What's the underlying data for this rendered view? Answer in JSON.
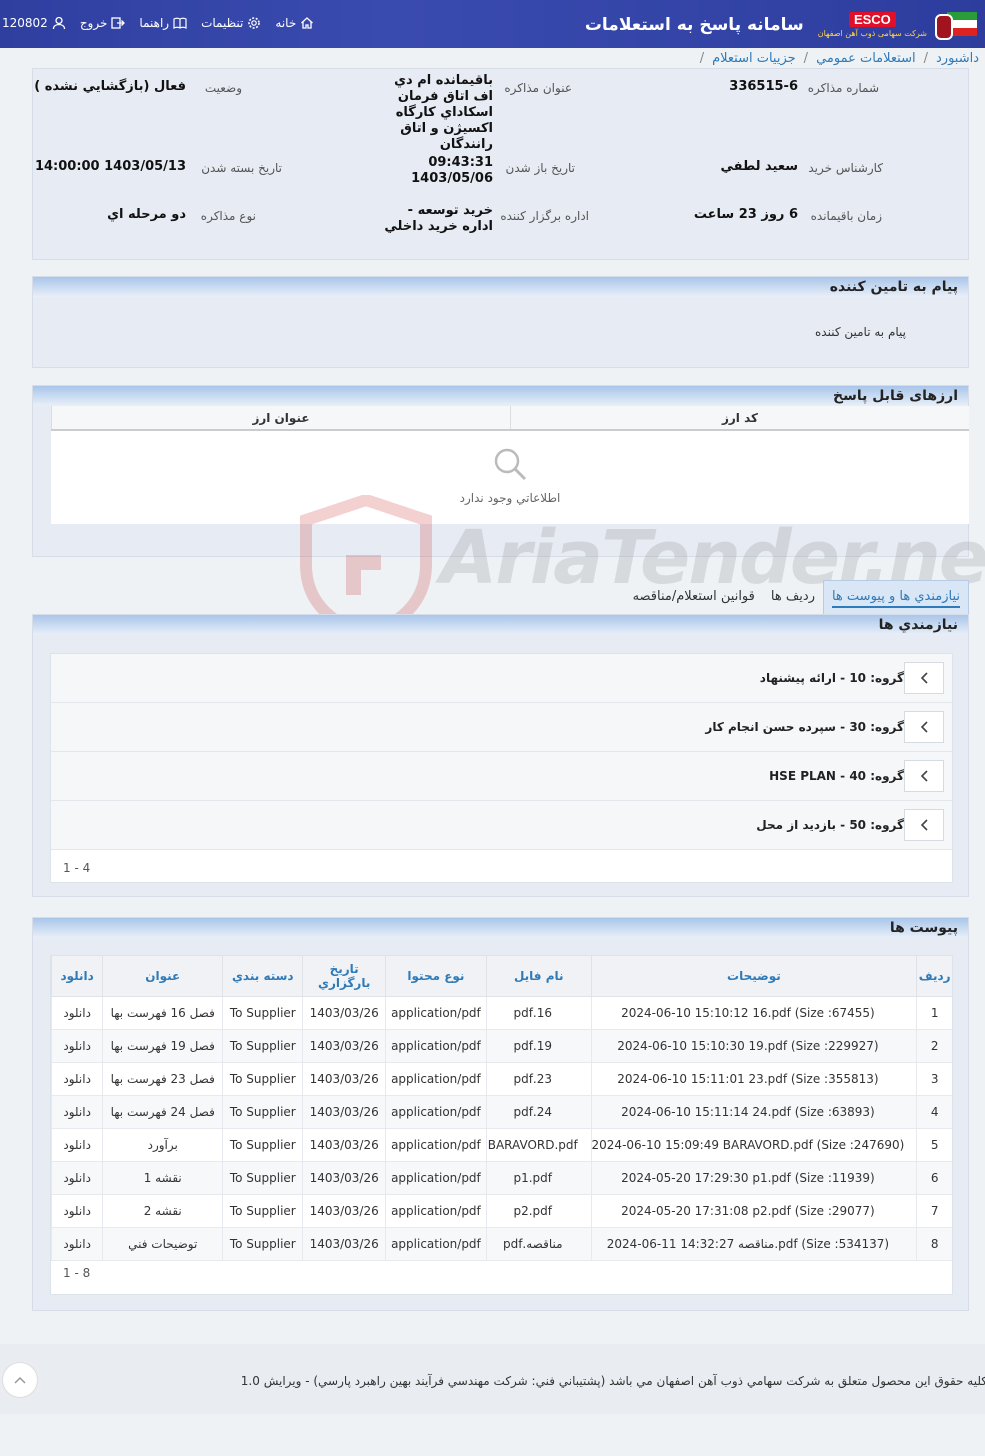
{
  "header": {
    "app_title": "سامانه پاسخ به استعلامات",
    "esco_mark": "ESCO",
    "esco_sub": "شرکت سهامی ذوب آهن اصفهان",
    "user_id": "120802",
    "logout": "خروج",
    "help": "راهنما",
    "settings": "تنظیمات",
    "home": "خانه"
  },
  "breadcrumb": [
    "داشبورد",
    "استعلامات عمومي",
    "جزييات استعلام"
  ],
  "info": {
    "number_label": "شماره مذاكره",
    "number_value": "336515-6",
    "title_label": "عنوان مذاكره",
    "title_value": "باقيمانده ام دي اف اتاق فرمان اسكاداي كارگاه اكسيژن و اتاق رانندگان",
    "status_label": "وضعيت",
    "status_value": "فعال (بازگشايي نشده )",
    "buyer_label": "كارشناس خريد",
    "buyer_value": "سعيد لطفي",
    "open_label": "تاريخ باز شدن",
    "open_time": "09:43:31",
    "open_date": "1403/05/06",
    "close_label": "تاريخ بسته شدن",
    "close_value": "1403/05/13 14:00:00",
    "remain_label": "زمان باقيمانده",
    "remain_value": "6 روز 23 ساعت",
    "dept_label": "اداره برگزار كننده",
    "dept_value": "خريد توسعه - اداره خريد داخلي",
    "type_label": "نوع مذاكره",
    "type_value": "دو مرحله اي"
  },
  "message": {
    "title": "پیام به تامین کننده",
    "text": "پیام به تامین کننده"
  },
  "currency": {
    "title": "ارزهای قابل پاسخ",
    "col_code": "کد ارز",
    "col_title": "عنوان ارز",
    "empty": "اطلاعاتي وجود ندارد"
  },
  "watermark": "AriaTender.neT",
  "tabs": [
    "نیازمندي ها و پیوست ها",
    "رديف ها",
    "قوانين استعلام/مناقصه"
  ],
  "requirements": {
    "title": "نيازمندي ها",
    "groups": [
      "گروه: 10 - ارائه پیشنهاد",
      "گروه: 30 - سپرده حسن انجام کار",
      "گروه: 40 - HSE PLAN",
      "گروه: 50 - بازديد از محل"
    ],
    "pager": "1 - 4"
  },
  "attachments": {
    "title": "پیوست ها",
    "columns": [
      "رديف",
      "توضيحات",
      "نام فايل",
      "نوع محتوا",
      "تاريخ بارگزاري",
      "دسته بندي",
      "عنوان",
      "دانلود"
    ],
    "rows": [
      [
        "1",
        "2024-06-10 15:10:12 16.pdf (Size :67455)",
        "16.pdf",
        "application/pdf",
        "1403/03/26",
        "To Supplier",
        "فصل 16 فهرست بها",
        "دانلود"
      ],
      [
        "2",
        "2024-06-10 15:10:30 19.pdf (Size :229927)",
        "19.pdf",
        "application/pdf",
        "1403/03/26",
        "To Supplier",
        "فصل 19 فهرست بها",
        "دانلود"
      ],
      [
        "3",
        "2024-06-10 15:11:01 23.pdf (Size :355813)",
        "23.pdf",
        "application/pdf",
        "1403/03/26",
        "To Supplier",
        "فصل 23 فهرست بها",
        "دانلود"
      ],
      [
        "4",
        "2024-06-10 15:11:14 24.pdf (Size :63893)",
        "24.pdf",
        "application/pdf",
        "1403/03/26",
        "To Supplier",
        "فصل 24 فهرست بها",
        "دانلود"
      ],
      [
        "5",
        "2024-06-10 15:09:49 BARAVORD.pdf (Size :247690)",
        "BARAVORD.pdf",
        "application/pdf",
        "1403/03/26",
        "To Supplier",
        "برآورد",
        "دانلود"
      ],
      [
        "6",
        "2024-05-20 17:29:30 p1.pdf (Size :11939)",
        "p1.pdf",
        "application/pdf",
        "1403/03/26",
        "To Supplier",
        "نقشه 1",
        "دانلود"
      ],
      [
        "7",
        "2024-05-20 17:31:08 p2.pdf (Size :29077)",
        "p2.pdf",
        "application/pdf",
        "1403/03/26",
        "To Supplier",
        "نقشه 2",
        "دانلود"
      ],
      [
        "8",
        "2024-06-11 14:32:27 مناقصه.pdf (Size :534137)",
        "مناقصه.pdf",
        "application/pdf",
        "1403/03/26",
        "To Supplier",
        "توضيحات فني",
        "دانلود"
      ]
    ],
    "pager": "1 - 8"
  },
  "footer": {
    "text": "كليه حقوق اين محصول متعلق به شركت سهامي ذوب آهن اصفهان مي باشد (پشتيباني فني: شركت مهندسي فرآيند بهين راهبرد پارسي) - ويرايش 1.0"
  },
  "colors": {
    "header_bg": "#2f3fa0",
    "link": "#2f7ab8",
    "panel_bg": "#e7ecf4",
    "esco_red": "#e0102a"
  }
}
